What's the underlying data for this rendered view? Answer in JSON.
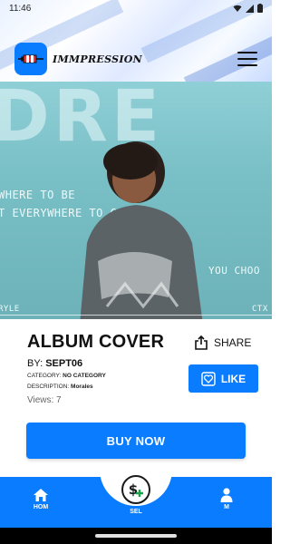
{
  "status_bar": {
    "time": "11:46",
    "icons": [
      "wifi-icon",
      "signal-icon",
      "battery-icon"
    ]
  },
  "header": {
    "logo_text": "IMMPRESSION",
    "menu_icon": "hamburger-menu-icon"
  },
  "hero": {
    "big_text": "DRE",
    "line_1": "WHERE TO BE",
    "line_2": "T EVERYWHERE TO GO",
    "line_3": "YOU CHOO",
    "corner_left": "RYLE",
    "corner_right": "CTX"
  },
  "product": {
    "title": "ALBUM COVER",
    "by_prefix": "BY: ",
    "by_value": "SEPT06",
    "category_prefix": "CATEGORY: ",
    "category_value": "NO CATEGORY",
    "description_prefix": "DESCRIPTION: ",
    "description_value": "Morales",
    "views": "Views: 7"
  },
  "actions": {
    "share_label": "SHARE",
    "like_label": "LIKE",
    "buy_label": "BUY NOW"
  },
  "bottom_nav": {
    "items": [
      {
        "label": "HOM",
        "icon": "home-icon"
      },
      {
        "label": "SEL",
        "icon": "dollar-plus-icon"
      },
      {
        "label": "M",
        "icon": "person-icon"
      }
    ]
  },
  "colors": {
    "accent": "#0a7cff",
    "text": "#111111"
  }
}
